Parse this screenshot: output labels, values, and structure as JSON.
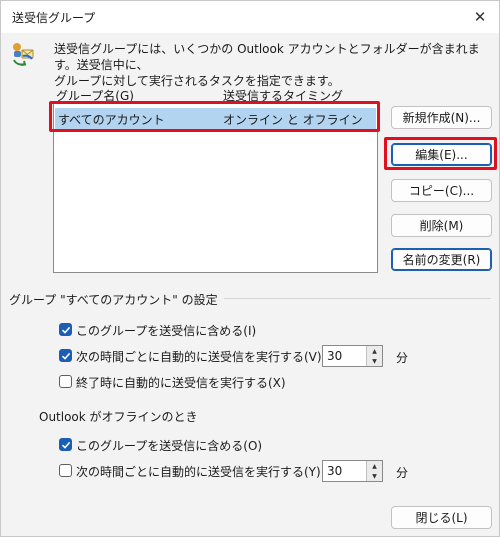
{
  "window": {
    "title": "送受信グループ",
    "close_glyph": "✕"
  },
  "description": {
    "line1": "送受信グループには、いくつかの Outlook アカウントとフォルダーが含まれます。送受信中に、",
    "line2": "グループに対して実行されるタスクを指定できます。"
  },
  "list": {
    "headers": [
      "グループ名(G)",
      "送受信するタイミング"
    ],
    "rows": [
      {
        "name": "すべてのアカウント",
        "timing": "オンライン と オフライン",
        "selected": true
      }
    ]
  },
  "buttons": {
    "new": "新規作成(N)...",
    "edit": "編集(E)...",
    "copy": "コピー(C)...",
    "delete": "削除(M)",
    "rename": "名前の変更(R)",
    "close": "閉じる(L)"
  },
  "settings": {
    "section_title": "グループ \"すべてのアカウント\" の設定",
    "online": {
      "include": {
        "label": "このグループを送受信に含める(I)",
        "checked": true
      },
      "auto": {
        "label": "次の時間ごとに自動的に送受信を実行する(V)",
        "checked": true,
        "value": "30",
        "unit": "分"
      },
      "on_exit": {
        "label": "終了時に自動的に送受信を実行する(X)",
        "checked": false
      }
    },
    "offline_title": "Outlook がオフラインのとき",
    "offline": {
      "include": {
        "label": "このグループを送受信に含める(O)",
        "checked": true
      },
      "auto": {
        "label": "次の時間ごとに自動的に送受信を実行する(Y)",
        "checked": false,
        "value": "30",
        "unit": "分"
      }
    }
  },
  "colors": {
    "accent": "#1a5fb4",
    "selection": "#b3d4f0",
    "highlight": "#e01020"
  },
  "icons": {
    "info": "send-receive-group-icon",
    "check": "check-icon",
    "spin_up": "▲",
    "spin_down": "▼"
  }
}
